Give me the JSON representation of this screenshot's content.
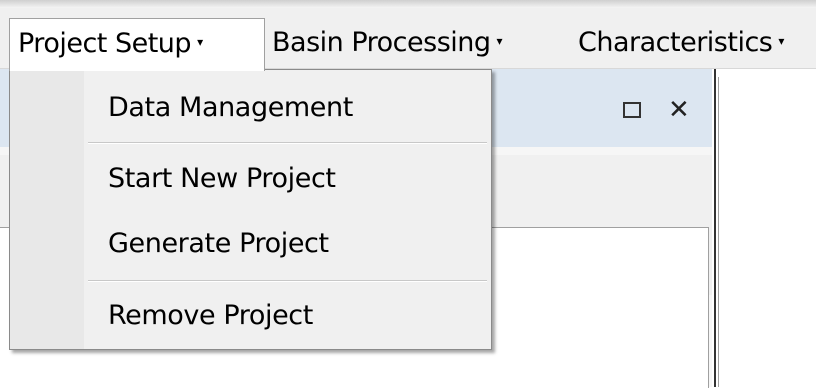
{
  "menubar": {
    "items": [
      {
        "label": "Project Setup",
        "arrow": "▾"
      },
      {
        "label": "Basin Processing",
        "arrow": "▾"
      },
      {
        "label": "Characteristics",
        "arrow": "▾"
      }
    ]
  },
  "dropdown": {
    "items": [
      {
        "label": "Data Management"
      },
      {
        "label": "Start New Project"
      },
      {
        "label": "Generate Project"
      },
      {
        "label": "Remove Project"
      }
    ]
  },
  "panel": {
    "close_glyph": "✕"
  },
  "icons": {
    "restore": "restore-icon",
    "close": "close-icon",
    "dropdown_arrow": "chevron-down-icon"
  }
}
